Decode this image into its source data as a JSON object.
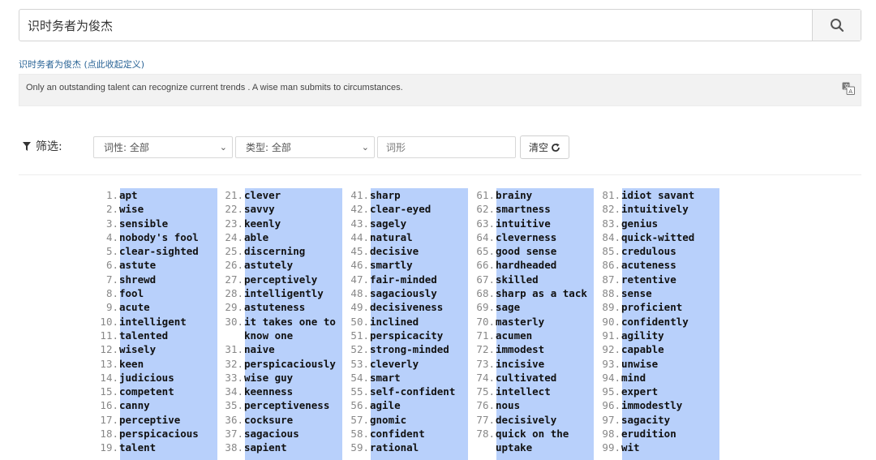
{
  "search": {
    "value": "识时务者为俊杰",
    "button_icon": "search-icon"
  },
  "definition": {
    "title": "识时务者为俊杰 (点此收起定义)",
    "text": "Only an outstanding talent can recognize current trends . A wise man submits to circumstances."
  },
  "filter": {
    "label": "筛选:",
    "pos_select": "词性: 全部",
    "type_select": "类型: 全部",
    "word_placeholder": "词形",
    "clear_label": "清空"
  },
  "colors": {
    "highlight": "#b8d0fb",
    "link": "#2a6496"
  },
  "words": [
    {
      "n": "1.",
      "w": "apt"
    },
    {
      "n": "2.",
      "w": "wise"
    },
    {
      "n": "3.",
      "w": "sensible"
    },
    {
      "n": "4.",
      "w": "nobody's fool"
    },
    {
      "n": "5.",
      "w": "clear-sighted"
    },
    {
      "n": "6.",
      "w": "astute"
    },
    {
      "n": "7.",
      "w": "shrewd"
    },
    {
      "n": "8.",
      "w": "fool"
    },
    {
      "n": "9.",
      "w": "acute"
    },
    {
      "n": "10.",
      "w": "intelligent"
    },
    {
      "n": "11.",
      "w": "talented"
    },
    {
      "n": "12.",
      "w": "wisely"
    },
    {
      "n": "13.",
      "w": "keen"
    },
    {
      "n": "14.",
      "w": "judicious"
    },
    {
      "n": "15.",
      "w": "competent"
    },
    {
      "n": "16.",
      "w": "canny"
    },
    {
      "n": "17.",
      "w": "perceptive"
    },
    {
      "n": "18.",
      "w": "perspicacious"
    },
    {
      "n": "19.",
      "w": "talent"
    },
    {
      "n": "21.",
      "w": "clever"
    },
    {
      "n": "22.",
      "w": "savvy"
    },
    {
      "n": "23.",
      "w": "keenly"
    },
    {
      "n": "24.",
      "w": "able"
    },
    {
      "n": "25.",
      "w": "discerning"
    },
    {
      "n": "26.",
      "w": "astutely"
    },
    {
      "n": "27.",
      "w": "perceptively"
    },
    {
      "n": "28.",
      "w": "intelligently"
    },
    {
      "n": "29.",
      "w": "astuteness"
    },
    {
      "n": "30.",
      "w": "it takes one to know one"
    },
    {
      "n": "31.",
      "w": "naive"
    },
    {
      "n": "32.",
      "w": "perspicaciously"
    },
    {
      "n": "33.",
      "w": "wise guy"
    },
    {
      "n": "34.",
      "w": "keenness"
    },
    {
      "n": "35.",
      "w": "perceptiveness"
    },
    {
      "n": "36.",
      "w": "cocksure"
    },
    {
      "n": "37.",
      "w": "sagacious"
    },
    {
      "n": "38.",
      "w": "sapient"
    },
    {
      "n": "41.",
      "w": "sharp"
    },
    {
      "n": "42.",
      "w": "clear-eyed"
    },
    {
      "n": "43.",
      "w": "sagely"
    },
    {
      "n": "44.",
      "w": "natural"
    },
    {
      "n": "45.",
      "w": "decisive"
    },
    {
      "n": "46.",
      "w": "smartly"
    },
    {
      "n": "47.",
      "w": "fair-minded"
    },
    {
      "n": "48.",
      "w": "sagaciously"
    },
    {
      "n": "49.",
      "w": "decisiveness"
    },
    {
      "n": "50.",
      "w": "inclined"
    },
    {
      "n": "51.",
      "w": "perspicacity"
    },
    {
      "n": "52.",
      "w": "strong-minded"
    },
    {
      "n": "53.",
      "w": "cleverly"
    },
    {
      "n": "54.",
      "w": "smart"
    },
    {
      "n": "55.",
      "w": "self-confident"
    },
    {
      "n": "56.",
      "w": "agile"
    },
    {
      "n": "57.",
      "w": "gnomic"
    },
    {
      "n": "58.",
      "w": "confident"
    },
    {
      "n": "59.",
      "w": "rational"
    },
    {
      "n": "61.",
      "w": "brainy"
    },
    {
      "n": "62.",
      "w": "smartness"
    },
    {
      "n": "63.",
      "w": "intuitive"
    },
    {
      "n": "64.",
      "w": "cleverness"
    },
    {
      "n": "65.",
      "w": "good sense"
    },
    {
      "n": "66.",
      "w": "hardheaded"
    },
    {
      "n": "67.",
      "w": "skilled"
    },
    {
      "n": "68.",
      "w": "sharp as a tack"
    },
    {
      "n": "69.",
      "w": "sage"
    },
    {
      "n": "70.",
      "w": "masterly"
    },
    {
      "n": "71.",
      "w": "acumen"
    },
    {
      "n": "72.",
      "w": "immodest"
    },
    {
      "n": "73.",
      "w": "incisive"
    },
    {
      "n": "74.",
      "w": "cultivated"
    },
    {
      "n": "75.",
      "w": "intellect"
    },
    {
      "n": "76.",
      "w": "nous"
    },
    {
      "n": "77.",
      "w": "decisively"
    },
    {
      "n": "78.",
      "w": "quick on the uptake"
    },
    {
      "n": "81.",
      "w": "idiot savant"
    },
    {
      "n": "82.",
      "w": "intuitively"
    },
    {
      "n": "83.",
      "w": "genius"
    },
    {
      "n": "84.",
      "w": "quick-witted"
    },
    {
      "n": "85.",
      "w": "credulous"
    },
    {
      "n": "86.",
      "w": "acuteness"
    },
    {
      "n": "87.",
      "w": "retentive"
    },
    {
      "n": "88.",
      "w": "sense"
    },
    {
      "n": "89.",
      "w": "proficient"
    },
    {
      "n": "90.",
      "w": "confidently"
    },
    {
      "n": "91.",
      "w": "agility"
    },
    {
      "n": "92.",
      "w": "capable"
    },
    {
      "n": "93.",
      "w": "unwise"
    },
    {
      "n": "94.",
      "w": "mind"
    },
    {
      "n": "95.",
      "w": "expert"
    },
    {
      "n": "96.",
      "w": "immodestly"
    },
    {
      "n": "97.",
      "w": "sagacity"
    },
    {
      "n": "98.",
      "w": "erudition"
    },
    {
      "n": "99.",
      "w": "wit"
    }
  ]
}
